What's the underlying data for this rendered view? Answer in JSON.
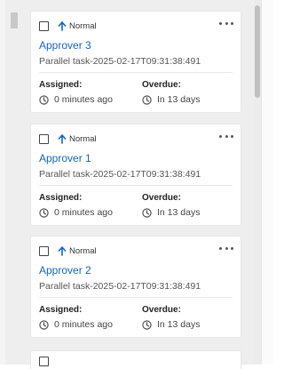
{
  "cards": [
    {
      "priority": "Normal",
      "title": "Approver 3",
      "subtitle": "Parallel task-2025-02-17T09:31:38:491",
      "assigned_label": "Assigned:",
      "assigned_value": "0 minutes ago",
      "overdue_label": "Overdue:",
      "overdue_value": "In 13 days"
    },
    {
      "priority": "Normal",
      "title": "Approver 1",
      "subtitle": "Parallel task-2025-02-17T09:31:38:491",
      "assigned_label": "Assigned:",
      "assigned_value": "0 minutes ago",
      "overdue_label": "Overdue:",
      "overdue_value": "In 13 days"
    },
    {
      "priority": "Normal",
      "title": "Approver 2",
      "subtitle": "Parallel task-2025-02-17T09:31:38:491",
      "assigned_label": "Assigned:",
      "assigned_value": "0 minutes ago",
      "overdue_label": "Overdue:",
      "overdue_value": "In 13 days"
    }
  ],
  "colors": {
    "title": "#1565c0",
    "priority_arrow": "#1565c0",
    "panel_background": "#eeeeee"
  },
  "icons": {
    "priority": "arrow-up-icon",
    "time": "clock-icon",
    "menu": "more-horizontal-icon",
    "select": "checkbox"
  }
}
